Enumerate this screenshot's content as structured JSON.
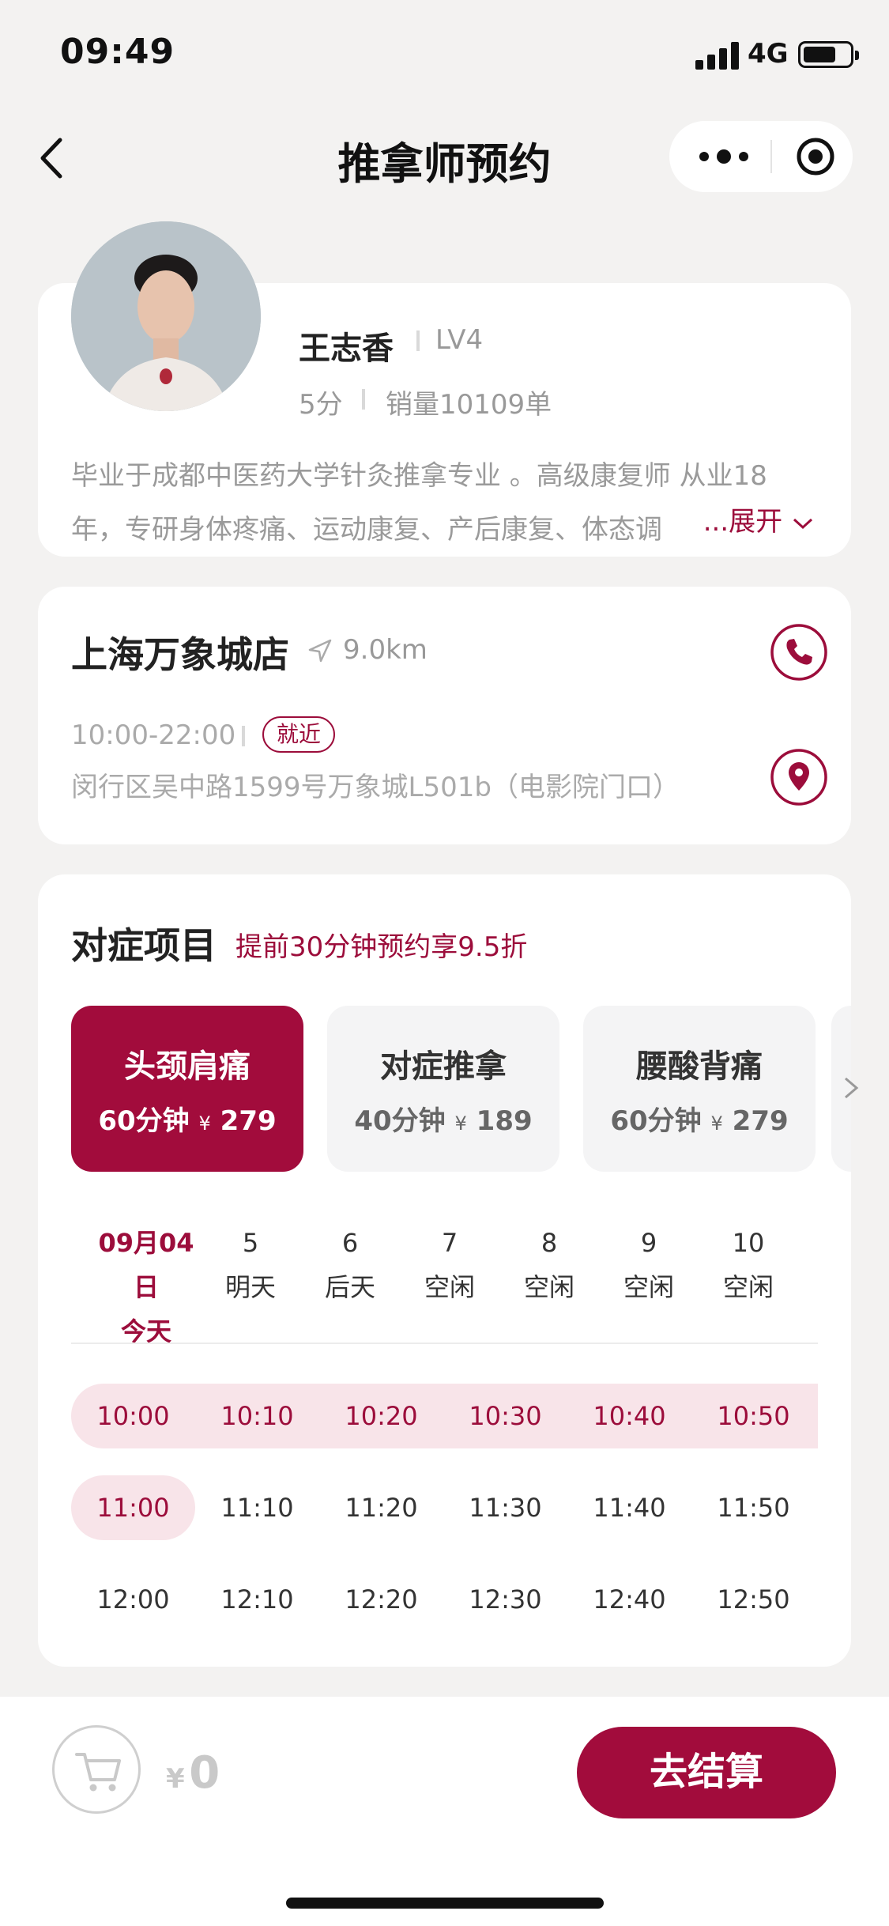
{
  "status_bar": {
    "time": "09:49",
    "network": "4G"
  },
  "nav": {
    "title": "推拿师预约"
  },
  "therapist": {
    "name": "王志香",
    "level": "LV4",
    "score": "5分",
    "sales": "销量10109单",
    "description_line1": "毕业于成都中医药大学针灸推拿专业 。高级康复师 从业18",
    "description_line2": "年，专研身体疼痛、运动康复、产后康复、体态调",
    "expand_label": "...展开"
  },
  "store": {
    "name": "上海万象城店",
    "distance": "9.0km",
    "hours": "10:00-22:00",
    "badge": "就近",
    "address": "闵行区吴中路1599号万象城L501b（电影院门口）"
  },
  "services": {
    "title": "对症项目",
    "promo": "提前30分钟预约享9.5折",
    "items": [
      {
        "name": "头颈肩痛",
        "duration": "60分钟",
        "currency": "¥",
        "price": "279",
        "active": true
      },
      {
        "name": "对症推拿",
        "duration": "40分钟",
        "currency": "¥",
        "price": "189",
        "active": false
      },
      {
        "name": "腰酸背痛",
        "duration": "60分钟",
        "currency": "¥",
        "price": "279",
        "active": false
      }
    ],
    "dates": [
      {
        "day": "09月04日",
        "label": "今天",
        "active": true
      },
      {
        "day": "5",
        "label": "明天"
      },
      {
        "day": "6",
        "label": "后天"
      },
      {
        "day": "7",
        "label": "空闲"
      },
      {
        "day": "8",
        "label": "空闲"
      },
      {
        "day": "9",
        "label": "空闲"
      },
      {
        "day": "10",
        "label": "空闲"
      }
    ],
    "slots": [
      [
        "10:00",
        "10:10",
        "10:20",
        "10:30",
        "10:40",
        "10:50"
      ],
      [
        "11:00",
        "11:10",
        "11:20",
        "11:30",
        "11:40",
        "11:50"
      ],
      [
        "12:00",
        "12:10",
        "12:20",
        "12:30",
        "12:40",
        "12:50"
      ]
    ],
    "taken_slots": [
      "10:00",
      "10:10",
      "10:20",
      "10:30",
      "10:40",
      "10:50",
      "11:00"
    ]
  },
  "cart": {
    "currency": "¥",
    "total": "0",
    "checkout_label": "去结算"
  },
  "colors": {
    "accent": "#a20c3c",
    "accent_light": "#f8e4e9",
    "background": "#f3f2f1"
  },
  "icons": [
    "back-chevron-icon",
    "more-dots-icon",
    "target-icon",
    "navigation-arrow-icon",
    "phone-icon",
    "location-pin-icon",
    "chevron-right-icon",
    "chevron-down-icon",
    "cart-icon"
  ]
}
